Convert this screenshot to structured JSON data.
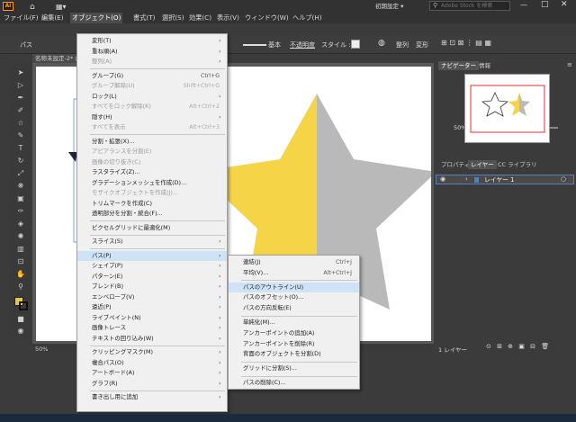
{
  "menubar": [
    "ファイル(F)",
    "編集(E)",
    "オブジェクト(O)",
    "書式(T)",
    "選択(S)",
    "効果(C)",
    "表示(V)",
    "ウィンドウ(W)",
    "ヘルプ(H)"
  ],
  "workspace": "初期設定",
  "search_placeholder": "Adobe Stock を検索",
  "control": {
    "path_label": "パス",
    "stroke_style": "基本",
    "opacity": "不透明度",
    "style": "スタイル :",
    "align": "整列",
    "transform": "変形"
  },
  "doc_tab": "名称未設定-2* @",
  "zoom": "50%",
  "right_panel": {
    "tabs_top": [
      "ナビゲーター",
      "情報"
    ],
    "nav_zoom": "50%",
    "tabs_mid": [
      "プロパティ",
      "レイヤー",
      "CC ライブラリ"
    ],
    "layer_name": "レイヤー 1",
    "layer_count": "1 レイヤー"
  },
  "object_menu": [
    {
      "label": "変形(T)",
      "arrow": true
    },
    {
      "label": "重ね順(A)",
      "arrow": true
    },
    {
      "label": "整列(A)",
      "arrow": true,
      "disabled": true
    },
    {
      "sep": true
    },
    {
      "label": "グループ(G)",
      "shortcut": "Ctrl+G"
    },
    {
      "label": "グループ解除(U)",
      "shortcut": "Shift+Ctrl+G",
      "disabled": true
    },
    {
      "label": "ロック(L)",
      "arrow": true
    },
    {
      "label": "すべてをロック解除(K)",
      "shortcut": "Alt+Ctrl+2",
      "disabled": true
    },
    {
      "label": "隠す(H)",
      "arrow": true
    },
    {
      "label": "すべてを表示",
      "shortcut": "Alt+Ctrl+3",
      "disabled": true
    },
    {
      "sep": true
    },
    {
      "label": "分割・拡張(X)..."
    },
    {
      "label": "アピアランスを分割(E)",
      "disabled": true
    },
    {
      "label": "画像の切り抜き(C)",
      "disabled": true
    },
    {
      "label": "ラスタライズ(Z)..."
    },
    {
      "label": "グラデーションメッシュを作成(D)..."
    },
    {
      "label": "モザイクオブジェクトを作成(J)...",
      "disabled": true
    },
    {
      "label": "トリムマークを作成(C)"
    },
    {
      "label": "透明部分を分割・統合(F)..."
    },
    {
      "sep": true
    },
    {
      "label": "ピクセルグリッドに最適化(M)"
    },
    {
      "sep": true
    },
    {
      "label": "スライス(S)",
      "arrow": true
    },
    {
      "sep": true
    },
    {
      "label": "パス(P)",
      "arrow": true,
      "highlight": true
    },
    {
      "label": "シェイプ(P)",
      "arrow": true
    },
    {
      "label": "パターン(E)",
      "arrow": true
    },
    {
      "label": "ブレンド(B)",
      "arrow": true
    },
    {
      "label": "エンベロープ(V)",
      "arrow": true
    },
    {
      "label": "遠近(P)",
      "arrow": true
    },
    {
      "label": "ライブペイント(N)",
      "arrow": true
    },
    {
      "label": "画像トレース",
      "arrow": true
    },
    {
      "label": "テキストの回り込み(W)",
      "arrow": true
    },
    {
      "sep": true
    },
    {
      "label": "クリッピングマスク(M)",
      "arrow": true
    },
    {
      "label": "複合パス(O)",
      "arrow": true
    },
    {
      "label": "アートボード(A)",
      "arrow": true
    },
    {
      "label": "グラフ(R)",
      "arrow": true
    },
    {
      "sep": true
    },
    {
      "label": "書き出し用に追加",
      "arrow": true
    }
  ],
  "path_submenu": [
    {
      "label": "連結(J)",
      "shortcut": "Ctrl+J"
    },
    {
      "label": "平均(V)...",
      "shortcut": "Alt+Ctrl+J"
    },
    {
      "sep": true
    },
    {
      "label": "パスのアウトライン(U)",
      "highlight": true
    },
    {
      "label": "パスのオフセット(O)..."
    },
    {
      "label": "パスの方向反転(E)"
    },
    {
      "sep": true
    },
    {
      "label": "単純化(M)..."
    },
    {
      "label": "アンカーポイントの追加(A)"
    },
    {
      "label": "アンカーポイントを削除(R)"
    },
    {
      "label": "背面のオブジェクトを分割(D)"
    },
    {
      "sep": true
    },
    {
      "label": "グリッドに分割(S)..."
    },
    {
      "sep": true
    },
    {
      "label": "パスの削除(C)..."
    }
  ],
  "colors": {
    "star_left": "#f5d547",
    "star_right": "#b9b9b9",
    "highlight": "#cfe3f7"
  }
}
